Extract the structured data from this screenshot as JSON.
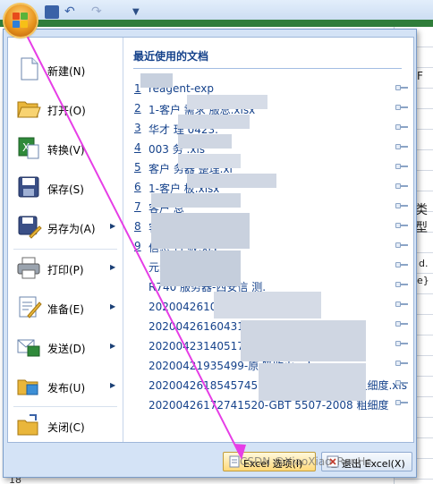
{
  "excel": {
    "column_label": "F",
    "fragment_1": "类型",
    "fragment_2": "d.",
    "fragment_3": "e}",
    "row_number": "18"
  },
  "recent": {
    "title": "最近使用的文档",
    "items": [
      {
        "num": "1",
        "name": "reagent-exp"
      },
      {
        "num": "2",
        "name": "1-客户      需求       服总.xlsx"
      },
      {
        "num": "3",
        "name": "华才         理     0423."
      },
      {
        "num": "4",
        "name": "003      务       .xls"
      },
      {
        "num": "5",
        "name": "客户  务器         整理.xl"
      },
      {
        "num": "6",
        "name": "1-客户              板.xlsx"
      },
      {
        "num": "7",
        "name": "客户       息"
      },
      {
        "num": "8",
        "name": "客户        息整"
      },
      {
        "num": "9",
        "name": "信息      合     板.xls"
      },
      {
        "num": "",
        "name": "元素"
      },
      {
        "num": "",
        "name": "R740 服务器-西安信      测."
      },
      {
        "num": "",
        "name": "20200426100553       测          录通用表"
      },
      {
        "num": "",
        "name": "20200426160431749      Y     004特殊          "
      },
      {
        "num": "",
        "name": "20200423140517757       高原     录通用表格"
      },
      {
        "num": "",
        "name": "20200421935499-原      吸收火    .xls"
      },
      {
        "num": "",
        "name": "20200426185457455-GBT 5507-2008  粗细度.xls"
      },
      {
        "num": "",
        "name": "20200426172741520-GBT 5507-2008  粗细度"
      }
    ]
  },
  "commands": [
    {
      "label": "新建(N)",
      "icon": "new-document-icon",
      "has_arrow": false
    },
    {
      "label": "打开(O)",
      "icon": "open-folder-icon",
      "has_arrow": false
    },
    {
      "label": "转换(V)",
      "icon": "convert-icon",
      "has_arrow": false
    },
    {
      "label": "保存(S)",
      "icon": "save-icon",
      "has_arrow": false
    },
    {
      "label": "另存为(A)",
      "icon": "save-as-icon",
      "has_arrow": true
    },
    {
      "label": "打印(P)",
      "icon": "printer-icon",
      "has_arrow": true
    },
    {
      "label": "准备(E)",
      "icon": "prepare-icon",
      "has_arrow": true
    },
    {
      "label": "发送(D)",
      "icon": "send-icon",
      "has_arrow": true
    },
    {
      "label": "发布(U)",
      "icon": "publish-icon",
      "has_arrow": true
    },
    {
      "label": "关闭(C)",
      "icon": "close-folder-icon",
      "has_arrow": false
    }
  ],
  "buttons": {
    "options": "Excel 选项(I)",
    "exit": "退出 Excel(X)"
  },
  "watermark": "CSDN @XiaoXiao_RenHe",
  "colors": {
    "accent": "#15428b",
    "pointer": "#e63ee6",
    "orb": "#e8951d"
  }
}
